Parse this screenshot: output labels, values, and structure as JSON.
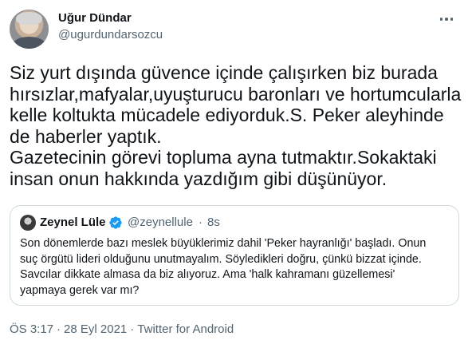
{
  "author": {
    "display_name": "Uğur Dündar",
    "handle": "@ugurdundarsozcu",
    "avatar_icon": "profile-photo"
  },
  "tweet": {
    "text": "Siz yurt dışında güvence içinde çalışırken biz burada\nhırsızlar,mafyalar,uyuşturucu baronları ve hortumcularla\nkelle koltukta mücadele ediyorduk.S. Peker aleyhinde\nde haberler yaptık.\nGazetecinin görevi topluma ayna tutmaktır.Sokaktaki\ninsan onun hakkında yazdığım gibi düşünüyor."
  },
  "quoted_tweet": {
    "display_name": "Zeynel Lüle",
    "verified_icon": "verified-badge",
    "handle": "@zeynellule",
    "separator": "·",
    "time": "8s",
    "text": "Son dönemlerde bazı meslek büyüklerimiz dahil 'Peker hayranlığı' başladı. Onun\nsuç örgütü lideri olduğunu unutmayalım. Söyledikleri doğru, çünkü bizzat içinde.\nSavcılar dikkate almasa da biz alıyoruz. Ama 'halk kahramanı güzellemesi'\nyapmaya gerek var mı?"
  },
  "meta": {
    "time": "ÖS 3:17",
    "dot1": "·",
    "date": "28 Eyl 2021",
    "dot2": "·",
    "source": "Twitter for Android"
  },
  "colors": {
    "text": "#0f1419",
    "secondary": "#536471",
    "border": "#cfd9de",
    "verified": "#1d9bf0"
  }
}
